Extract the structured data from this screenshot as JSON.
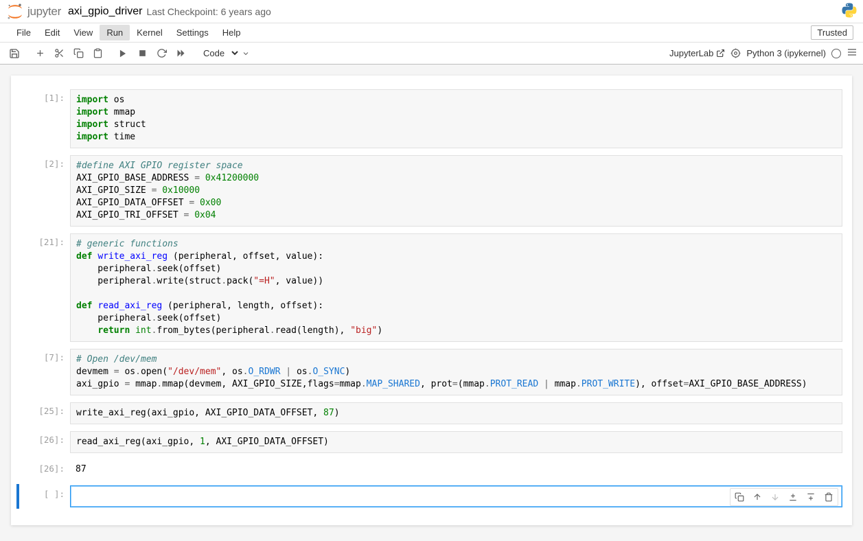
{
  "header": {
    "brand": "jupyter",
    "title": "axi_gpio_driver",
    "checkpoint": "Last Checkpoint: 6 years ago"
  },
  "menubar": {
    "items": [
      "File",
      "Edit",
      "View",
      "Run",
      "Kernel",
      "Settings",
      "Help"
    ],
    "active_index": 3,
    "trusted_label": "Trusted"
  },
  "toolbar": {
    "cell_type": "Code",
    "jupyterlab_link": "JupyterLab",
    "kernel_label": "Python 3 (ipykernel)"
  },
  "cells": [
    {
      "prompt": "[1]:",
      "tokens": [
        [
          "kn",
          "import"
        ],
        [
          "nm",
          " os\n"
        ],
        [
          "kn",
          "import"
        ],
        [
          "nm",
          " mmap\n"
        ],
        [
          "kn",
          "import"
        ],
        [
          "nm",
          " struct\n"
        ],
        [
          "kn",
          "import"
        ],
        [
          "nm",
          " time"
        ]
      ]
    },
    {
      "prompt": "[2]:",
      "tokens": [
        [
          "cm",
          "#define AXI GPIO register space"
        ],
        [
          "nm",
          "\n"
        ],
        [
          "nm",
          "AXI_GPIO_BASE_ADDRESS "
        ],
        [
          "op",
          "="
        ],
        [
          "nm",
          " "
        ],
        [
          "num",
          "0x41200000"
        ],
        [
          "nm",
          "\n"
        ],
        [
          "nm",
          "AXI_GPIO_SIZE "
        ],
        [
          "op",
          "="
        ],
        [
          "nm",
          " "
        ],
        [
          "num",
          "0x10000"
        ],
        [
          "nm",
          "\n"
        ],
        [
          "nm",
          "AXI_GPIO_DATA_OFFSET "
        ],
        [
          "op",
          "="
        ],
        [
          "nm",
          " "
        ],
        [
          "num",
          "0x00"
        ],
        [
          "nm",
          "\n"
        ],
        [
          "nm",
          "AXI_GPIO_TRI_OFFSET "
        ],
        [
          "op",
          "="
        ],
        [
          "nm",
          " "
        ],
        [
          "num",
          "0x04"
        ]
      ]
    },
    {
      "prompt": "[21]:",
      "tokens": [
        [
          "cm",
          "# generic functions"
        ],
        [
          "nm",
          "\n"
        ],
        [
          "kw",
          "def"
        ],
        [
          "nm",
          " "
        ],
        [
          "fn",
          "write_axi_reg"
        ],
        [
          "nm",
          " (peripheral, offset, value):\n"
        ],
        [
          "nm",
          "    peripheral"
        ],
        [
          "op",
          "."
        ],
        [
          "nm",
          "seek(offset)\n"
        ],
        [
          "nm",
          "    peripheral"
        ],
        [
          "op",
          "."
        ],
        [
          "nm",
          "write(struct"
        ],
        [
          "op",
          "."
        ],
        [
          "nm",
          "pack("
        ],
        [
          "str",
          "\"=H\""
        ],
        [
          "nm",
          ", value))\n"
        ],
        [
          "nm",
          "\n"
        ],
        [
          "kw",
          "def"
        ],
        [
          "nm",
          " "
        ],
        [
          "fn",
          "read_axi_reg"
        ],
        [
          "nm",
          " (peripheral, length, offset):\n"
        ],
        [
          "nm",
          "    peripheral"
        ],
        [
          "op",
          "."
        ],
        [
          "nm",
          "seek(offset)\n"
        ],
        [
          "nm",
          "    "
        ],
        [
          "kw",
          "return"
        ],
        [
          "nm",
          " "
        ],
        [
          "builtin",
          "int"
        ],
        [
          "op",
          "."
        ],
        [
          "nm",
          "from_bytes(peripheral"
        ],
        [
          "op",
          "."
        ],
        [
          "nm",
          "read(length), "
        ],
        [
          "str",
          "\"big\""
        ],
        [
          "nm",
          ")"
        ]
      ]
    },
    {
      "prompt": "[7]:",
      "tokens": [
        [
          "cm",
          "# Open /dev/mem"
        ],
        [
          "nm",
          "\n"
        ],
        [
          "nm",
          "devmem "
        ],
        [
          "op",
          "="
        ],
        [
          "nm",
          " os"
        ],
        [
          "op",
          "."
        ],
        [
          "nm",
          "open("
        ],
        [
          "str",
          "\"/dev/mem\""
        ],
        [
          "nm",
          ", os"
        ],
        [
          "op",
          "."
        ],
        [
          "attr",
          "O_RDWR"
        ],
        [
          "nm",
          " "
        ],
        [
          "op",
          "|"
        ],
        [
          "nm",
          " os"
        ],
        [
          "op",
          "."
        ],
        [
          "attr",
          "O_SYNC"
        ],
        [
          "nm",
          ")\n"
        ],
        [
          "nm",
          "axi_gpio "
        ],
        [
          "op",
          "="
        ],
        [
          "nm",
          " mmap"
        ],
        [
          "op",
          "."
        ],
        [
          "nm",
          "mmap(devmem, AXI_GPIO_SIZE,flags"
        ],
        [
          "op",
          "="
        ],
        [
          "nm",
          "mmap"
        ],
        [
          "op",
          "."
        ],
        [
          "attr",
          "MAP_SHARED"
        ],
        [
          "nm",
          ", prot"
        ],
        [
          "op",
          "="
        ],
        [
          "nm",
          "(mmap"
        ],
        [
          "op",
          "."
        ],
        [
          "attr",
          "PROT_READ"
        ],
        [
          "nm",
          " "
        ],
        [
          "op",
          "|"
        ],
        [
          "nm",
          " mmap"
        ],
        [
          "op",
          "."
        ],
        [
          "attr",
          "PROT_WRITE"
        ],
        [
          "nm",
          "), offset"
        ],
        [
          "op",
          "="
        ],
        [
          "nm",
          "AXI_GPIO_BASE_ADDRESS)"
        ]
      ]
    },
    {
      "prompt": "[25]:",
      "tokens": [
        [
          "nm",
          "write_axi_reg(axi_gpio, AXI_GPIO_DATA_OFFSET, "
        ],
        [
          "num",
          "87"
        ],
        [
          "nm",
          ")"
        ]
      ]
    },
    {
      "prompt": "[26]:",
      "tokens": [
        [
          "nm",
          "read_axi_reg(axi_gpio, "
        ],
        [
          "num",
          "1"
        ],
        [
          "nm",
          ", AXI_GPIO_DATA_OFFSET)"
        ]
      ]
    }
  ],
  "output": {
    "prompt": "[26]:",
    "text": "87"
  },
  "active_cell": {
    "prompt": "[ ]:"
  }
}
